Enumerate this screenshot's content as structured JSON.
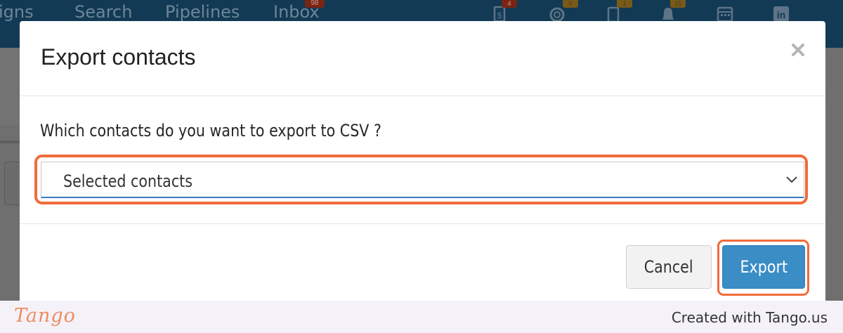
{
  "background_app": {
    "nav_links": [
      "igns",
      "Search",
      "Pipelines",
      "Inbox"
    ],
    "inbox_badge": "98",
    "nav_icons": [
      {
        "name": "billing-icon",
        "glyph": "$",
        "badge": "4",
        "badge_color": "#7a2414"
      },
      {
        "name": "support-icon",
        "glyph": "◎",
        "badge": "6",
        "badge_color": "#7a5a18"
      },
      {
        "name": "tasks-icon",
        "glyph": "▯",
        "badge": "1",
        "badge_color": "#7a5a18"
      },
      {
        "name": "notifications-icon",
        "glyph": "▲",
        "badge": "15",
        "badge_color": "#7a5a18"
      },
      {
        "name": "calendar-icon",
        "glyph": "▦",
        "badge": "",
        "badge_color": ""
      },
      {
        "name": "linkedin-icon",
        "glyph": "in",
        "badge": "",
        "badge_color": ""
      }
    ]
  },
  "modal": {
    "title": "Export contacts",
    "close_label": "×",
    "question": "Which contacts do you want to export to CSV ?",
    "select": {
      "value": "Selected contacts"
    },
    "buttons": {
      "cancel": "Cancel",
      "export": "Export"
    }
  },
  "footer": {
    "logo": "Tango",
    "credit": "Created with Tango.us"
  },
  "colors": {
    "highlight": "#f26b3a",
    "export_button": "#3a8dc5",
    "nav_background": "#123a55"
  }
}
